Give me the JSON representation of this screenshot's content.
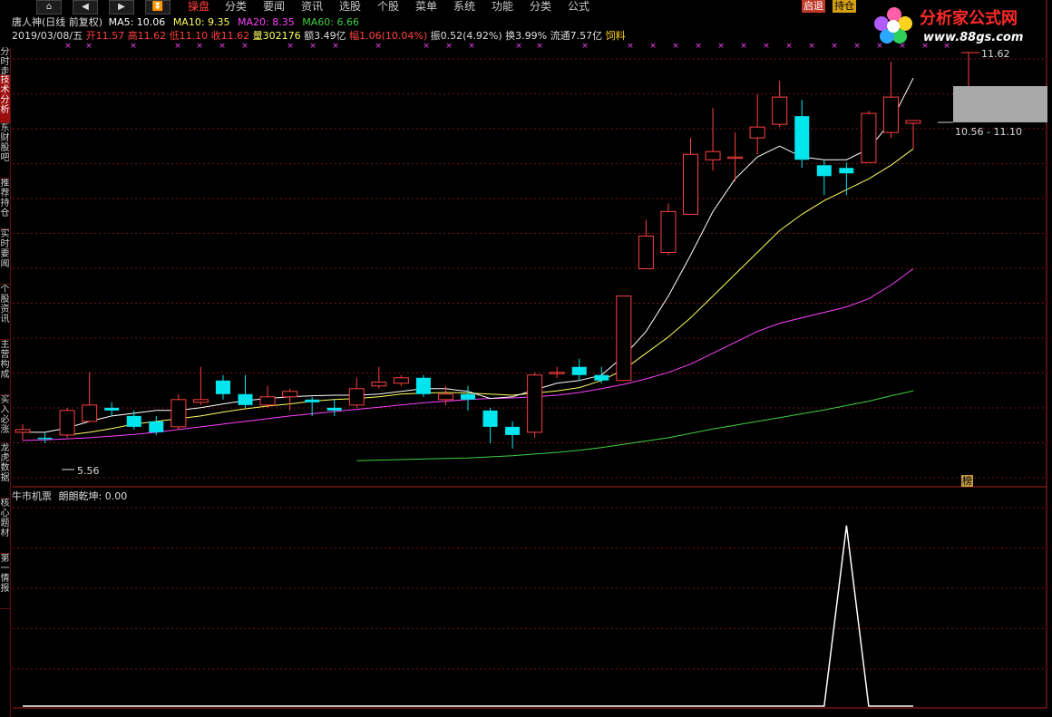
{
  "menubar": {
    "nav": [
      "⌂",
      "◀",
      "▶",
      "⏬"
    ],
    "items": [
      "操盘",
      "分类",
      "要闻",
      "资讯",
      "选股",
      "个股",
      "菜单",
      "系统",
      "功能",
      "分类",
      "公式"
    ],
    "active_index": 0,
    "tag_buttons": [
      "启退",
      "持仓"
    ]
  },
  "logo": {
    "name": "分析家公式网",
    "url": "www.88gs.com"
  },
  "info": {
    "title": "唐人神(日线 前复权)",
    "ma5": "MA5: 10.06",
    "ma10": "MA10: 9.35",
    "ma20": "MA20: 8.35",
    "ma60": "MA60: 6.66",
    "date": "2019/03/08/五",
    "open": "开11.57",
    "high": "高11.62",
    "low": "低11.10",
    "close": "收11.62",
    "volume": "量302176",
    "amount": "额3.49亿",
    "change": "幅1.06(10.04%)",
    "amplitude": "振0.52(4.92%)",
    "turnover": "换3.99%",
    "float": "流通7.57亿",
    "feed": "饲料"
  },
  "sidebar": [
    "分时走势",
    "技术分析",
    "东财股吧",
    "推荐持仓",
    "实时要闻",
    "个股资讯",
    "主营构成",
    "买入必涨",
    "龙虎数据",
    "核心题材",
    "第一情报"
  ],
  "sidebar_active": 1,
  "chart_labels": {
    "high_marker": "11.62",
    "low_marker": "5.56",
    "price_range": "10.56 - 11.10",
    "bang": "榜"
  },
  "indicator": {
    "name": "牛市机票",
    "line_label": "朗朗乾坤: 0.00"
  },
  "colors": {
    "up": "#ff4040",
    "down": "#00e5ee",
    "ma5": "#ffffff",
    "ma10": "#ffff60",
    "ma20": "#ff40ff",
    "ma60": "#40d040",
    "grid": "#7a1212",
    "axis": "#aa2020"
  },
  "chart_data": [
    {
      "type": "candlestick",
      "title": "唐人神(日线 前复权)",
      "series_order": [
        "open",
        "close",
        "high",
        "low"
      ],
      "candles": [
        [
          5.9,
          5.95,
          6.05,
          5.75
        ],
        [
          5.8,
          5.78,
          5.9,
          5.7
        ],
        [
          5.85,
          6.3,
          6.35,
          5.8
        ],
        [
          6.1,
          6.4,
          7.0,
          6.1
        ],
        [
          6.35,
          6.3,
          6.45,
          6.2
        ],
        [
          6.2,
          6.0,
          6.3,
          5.95
        ],
        [
          6.1,
          5.9,
          6.2,
          5.85
        ],
        [
          6.0,
          6.5,
          6.6,
          5.95
        ],
        [
          6.45,
          6.5,
          7.1,
          6.4
        ],
        [
          6.85,
          6.6,
          6.95,
          6.5
        ],
        [
          6.6,
          6.4,
          6.95,
          6.35
        ],
        [
          6.4,
          6.55,
          6.75,
          6.35
        ],
        [
          6.55,
          6.65,
          6.7,
          6.3
        ],
        [
          6.5,
          6.45,
          6.55,
          6.2
        ],
        [
          6.35,
          6.3,
          6.5,
          6.2
        ],
        [
          6.4,
          6.7,
          6.9,
          6.35
        ],
        [
          6.75,
          6.82,
          7.1,
          6.7
        ],
        [
          6.8,
          6.9,
          6.95,
          6.75
        ],
        [
          6.9,
          6.6,
          6.95,
          6.55
        ],
        [
          6.5,
          6.6,
          6.75,
          6.4
        ],
        [
          6.6,
          6.5,
          6.75,
          6.3
        ],
        [
          6.3,
          6.0,
          6.35,
          5.7
        ],
        [
          6.0,
          5.85,
          6.1,
          5.6
        ],
        [
          5.9,
          6.95,
          7.0,
          5.8
        ],
        [
          7.0,
          7.0,
          7.1,
          6.9
        ],
        [
          7.1,
          6.95,
          7.25,
          6.85
        ],
        [
          6.95,
          6.85,
          7.1,
          6.8
        ],
        [
          6.85,
          8.4,
          8.4,
          6.85
        ],
        [
          8.9,
          9.5,
          9.8,
          8.9
        ],
        [
          9.2,
          9.95,
          10.1,
          9.15
        ],
        [
          9.9,
          11.0,
          11.3,
          9.9
        ],
        [
          10.9,
          11.05,
          11.85,
          10.7
        ],
        [
          10.95,
          10.95,
          11.4,
          10.5
        ],
        [
          11.3,
          11.5,
          12.1,
          11.0
        ],
        [
          11.55,
          12.05,
          12.35,
          11.5
        ],
        [
          11.7,
          10.9,
          12.0,
          10.75
        ],
        [
          10.8,
          10.6,
          10.9,
          10.25
        ],
        [
          10.75,
          10.65,
          10.85,
          10.25
        ],
        [
          10.85,
          11.75,
          11.8,
          10.95
        ],
        [
          11.4,
          12.05,
          12.7,
          11.3
        ],
        [
          11.57,
          11.62,
          11.62,
          11.1
        ]
      ],
      "ma5": [
        5.9,
        5.9,
        5.98,
        6.1,
        6.2,
        6.25,
        6.3,
        6.3,
        6.35,
        6.42,
        6.48,
        6.52,
        6.55,
        6.57,
        6.58,
        6.58,
        6.6,
        6.65,
        6.7,
        6.7,
        6.65,
        6.52,
        6.55,
        6.68,
        6.8,
        6.85,
        6.95,
        7.3,
        7.75,
        8.4,
        9.15,
        9.95,
        10.55,
        10.95,
        11.15,
        10.95,
        10.9,
        10.9,
        11.1,
        11.6,
        12.4
      ],
      "ma10": [
        null,
        null,
        5.85,
        5.9,
        5.97,
        6.05,
        6.1,
        6.15,
        6.2,
        6.27,
        6.33,
        6.38,
        6.42,
        6.47,
        6.5,
        6.52,
        6.55,
        6.6,
        6.62,
        6.63,
        6.62,
        6.6,
        6.58,
        6.62,
        6.66,
        6.72,
        6.85,
        7.05,
        7.35,
        7.65,
        8.0,
        8.4,
        8.8,
        9.2,
        9.6,
        9.9,
        10.15,
        10.35,
        10.55,
        10.8,
        11.1
      ],
      "ma20": [
        5.75,
        5.76,
        5.78,
        5.8,
        5.83,
        5.86,
        5.9,
        5.95,
        6.0,
        6.05,
        6.1,
        6.15,
        6.2,
        6.24,
        6.28,
        6.32,
        6.36,
        6.4,
        6.44,
        6.47,
        6.5,
        6.52,
        6.53,
        6.55,
        6.58,
        6.63,
        6.7,
        6.78,
        6.88,
        7.0,
        7.15,
        7.35,
        7.55,
        7.75,
        7.9,
        8.0,
        8.1,
        8.2,
        8.35,
        8.6,
        8.9
      ],
      "ma60": [
        null,
        null,
        null,
        null,
        null,
        null,
        null,
        null,
        null,
        null,
        null,
        null,
        null,
        null,
        null,
        5.38,
        5.39,
        5.4,
        5.41,
        5.42,
        5.43,
        5.45,
        5.47,
        5.5,
        5.53,
        5.57,
        5.62,
        5.68,
        5.74,
        5.8,
        5.88,
        5.96,
        6.03,
        6.1,
        6.17,
        6.24,
        6.31,
        6.39,
        6.47,
        6.57,
        6.66
      ],
      "ylim": [
        5.1,
        12.8
      ]
    },
    {
      "type": "line",
      "title": "牛市机票",
      "series": [
        {
          "name": "朗朗乾坤",
          "values": [
            0,
            0,
            0,
            0,
            0,
            0,
            0,
            0,
            0,
            0,
            0,
            0,
            0,
            0,
            0,
            0,
            0,
            0,
            0,
            0,
            0,
            0,
            0,
            0,
            0,
            0,
            0,
            0,
            0,
            0,
            0,
            0,
            0,
            0,
            0,
            0,
            0,
            1,
            0,
            0,
            0
          ]
        }
      ],
      "ylim": [
        0,
        1.1
      ]
    }
  ]
}
